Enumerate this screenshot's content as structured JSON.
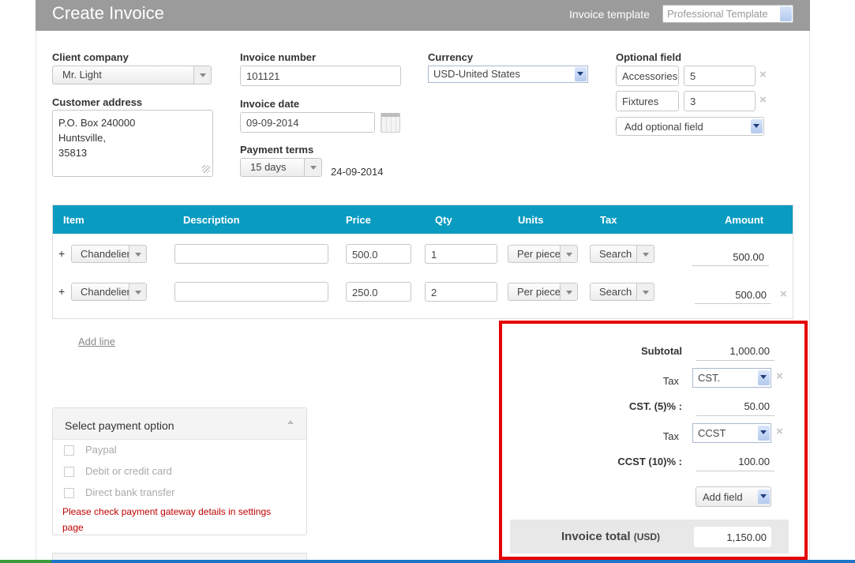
{
  "header": {
    "title": "Create Invoice",
    "template_label": "Invoice template",
    "template_value": "Professional Template"
  },
  "client": {
    "label": "Client company",
    "value": "Mr. Light"
  },
  "address": {
    "label": "Customer address",
    "lines": [
      "P.O. Box 240000",
      "Huntsville,",
      "35813"
    ]
  },
  "invoice_number": {
    "label": "Invoice number",
    "value": "101121"
  },
  "invoice_date": {
    "label": "Invoice date",
    "value": "09-09-2014"
  },
  "payment_terms": {
    "label": "Payment terms",
    "value": "15 days",
    "due_date": "24-09-2014"
  },
  "currency": {
    "label": "Currency",
    "value": "USD-United States"
  },
  "optional": {
    "label": "Optional field",
    "fields": [
      {
        "name": "Accessories",
        "value": "5"
      },
      {
        "name": "Fixtures",
        "value": "3"
      }
    ],
    "add_label": "Add optional field"
  },
  "table": {
    "headers": {
      "item": "Item",
      "description": "Description",
      "price": "Price",
      "qty": "Qty",
      "units": "Units",
      "tax": "Tax",
      "amount": "Amount"
    },
    "rows": [
      {
        "plus": "+",
        "item": "Chandeliers",
        "description": "",
        "price": "500.0",
        "qty": "1",
        "units": "Per piece",
        "tax": "Search",
        "amount": "500.00"
      },
      {
        "plus": "+",
        "item": "Chandeliers",
        "description": "",
        "price": "250.0",
        "qty": "2",
        "units": "Per piece",
        "tax": "Search",
        "amount": "500.00"
      }
    ],
    "add_line": "Add line"
  },
  "totals": {
    "subtotal_label": "Subtotal",
    "subtotal_value": "1,000.00",
    "taxes": [
      {
        "label": "Tax",
        "select": "CST.",
        "line_label": "CST. (5)% :",
        "line_value": "50.00"
      },
      {
        "label": "Tax",
        "select": "CCST",
        "line_label": "CCST (10)% :",
        "line_value": "100.00"
      }
    ],
    "add_field": "Add field",
    "invoice_total_label": "Invoice total",
    "invoice_total_currency": "(USD)",
    "invoice_total_value": "1,150.00"
  },
  "payment": {
    "title": "Select payment option",
    "options": [
      "Paypal",
      "Debit or credit card",
      "Direct bank transfer"
    ],
    "warning": "Please check payment gateway details in settings page"
  },
  "colors": {
    "header_bg": "#9b9b9b",
    "table_header_bg": "#0a9bc1",
    "highlight_frame": "#e60000",
    "warning_text": "#c00000"
  }
}
